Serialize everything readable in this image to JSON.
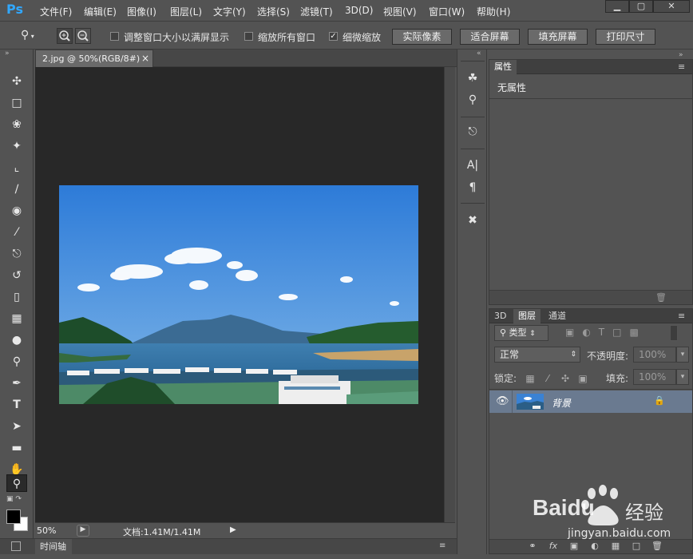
{
  "app": {
    "logo": "Ps"
  },
  "menu": [
    "文件(F)",
    "编辑(E)",
    "图像(I)",
    "图层(L)",
    "文字(Y)",
    "选择(S)",
    "滤镜(T)",
    "3D(D)",
    "视图(V)",
    "窗口(W)",
    "帮助(H)"
  ],
  "window_controls": {
    "minimize": "▁",
    "restore": "▢",
    "close": "✕"
  },
  "options": {
    "fit_window_label": "调整窗口大小以满屏显示",
    "fit_window_checked": false,
    "zoom_all_label": "缩放所有窗口",
    "zoom_all_checked": false,
    "scrubby_label": "细微缩放",
    "scrubby_checked": true,
    "btn_actual": "实际像素",
    "btn_fit": "适合屏幕",
    "btn_fill": "填充屏幕",
    "btn_print": "打印尺寸"
  },
  "document": {
    "tab_title": "2.jpg @ 50%(RGB/8#)",
    "close_glyph": "×"
  },
  "status": {
    "zoom": "50%",
    "doc_size": "文档:1.41M/1.41M"
  },
  "timeline": {
    "label": "时间轴"
  },
  "properties": {
    "tab": "属性",
    "content": "无属性"
  },
  "layers_panel": {
    "tabs": [
      "3D",
      "图层",
      "通道"
    ],
    "filter_label": "类型",
    "blend_mode": "正常",
    "opacity_label": "不透明度:",
    "opacity_value": "100%",
    "lock_label": "锁定:",
    "fill_label": "填充:",
    "fill_value": "100%",
    "layer_name": "背景"
  },
  "watermark": {
    "brand": "Baidu",
    "brand_cn": "经验",
    "url": "jingyan.baidu.com"
  },
  "colors": {
    "accent_blue": "#31a8ff",
    "canvas_bg": "#282828",
    "panel_bg": "#535353",
    "selected_layer": "#6a7a90"
  },
  "icons": {
    "toolbar": [
      "move-icon",
      "marquee-icon",
      "lasso-icon",
      "magic-wand-icon",
      "crop-icon",
      "eyedropper-icon",
      "healing-icon",
      "brush-icon",
      "stamp-icon",
      "history-brush-icon",
      "eraser-icon",
      "gradient-icon",
      "blur-icon",
      "dodge-icon",
      "pen-icon",
      "type-icon",
      "path-select-icon",
      "shape-icon",
      "hand-icon",
      "zoom-icon"
    ]
  }
}
